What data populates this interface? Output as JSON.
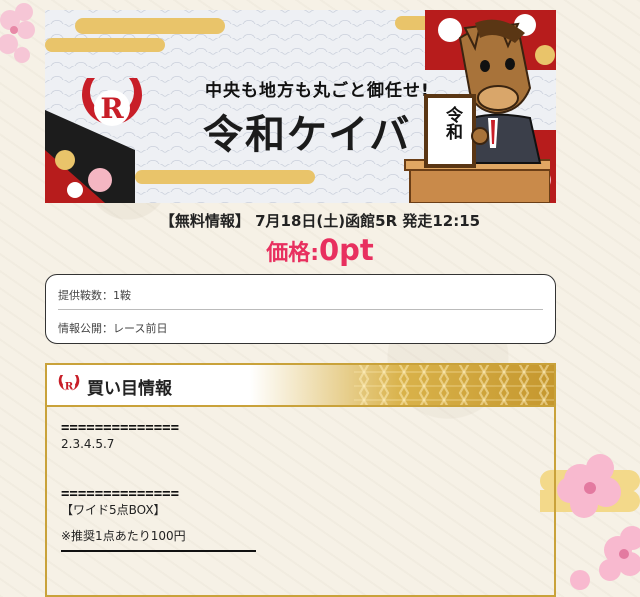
{
  "banner": {
    "tagline": "中央も地方も丸ごと御任せ!",
    "title": "令和ケイバ",
    "sign_text": "令和"
  },
  "race": {
    "info": "【無料情報】 7月18日(土)函館5R 発走12:15"
  },
  "price": {
    "label": "価格:",
    "value": "0pt"
  },
  "details": {
    "horses": "提供鞍数：1鞍",
    "release": "情報公開：レース前日"
  },
  "panel": {
    "title": "買い目情報",
    "separator1": "==============",
    "numbers": "2.3.4.5.7",
    "separator2": "==============",
    "bet_type": "【ワイド5点BOX】",
    "recommend": "※推奨1点あたり100円"
  },
  "colors": {
    "price": "#e8305f",
    "gold": "#c9a23a",
    "logo_red": "#c81e28"
  }
}
